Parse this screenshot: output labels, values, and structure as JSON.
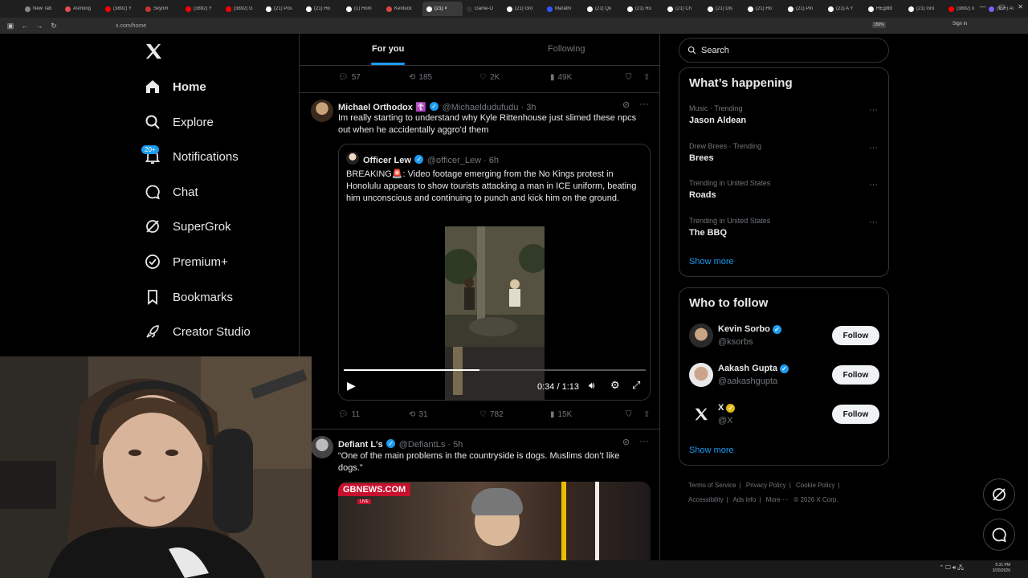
{
  "browser": {
    "tabs": [
      {
        "label": "New Tab",
        "color": "#888888"
      },
      {
        "label": "Asmong",
        "color": "#e44d4d"
      },
      {
        "label": "(3892) Y",
        "color": "#ff0000"
      },
      {
        "label": "Skyrim ",
        "color": "#cc3333"
      },
      {
        "label": "(3892) Y",
        "color": "#ff0000"
      },
      {
        "label": "(3892) G",
        "color": "#ff0000"
      },
      {
        "label": "(21) Pos",
        "color": "#ffffff"
      },
      {
        "label": "(21) Ho",
        "color": "#ffffff"
      },
      {
        "label": "(1) Hom",
        "color": "#ffffff"
      },
      {
        "label": "Kentuck",
        "color": "#d44"
      },
      {
        "label": "(21) ×",
        "color": "#ffffff",
        "active": true
      },
      {
        "label": "Game-O",
        "color": "#333"
      },
      {
        "label": "(21) Gro",
        "color": "#ffffff"
      },
      {
        "label": "Marathi",
        "color": "#3355ff"
      },
      {
        "label": "(21) Qu",
        "color": "#ffffff"
      },
      {
        "label": "(21) Ru",
        "color": "#ffffff"
      },
      {
        "label": "(21) Ch",
        "color": "#ffffff"
      },
      {
        "label": "(21) Dis",
        "color": "#ffffff"
      },
      {
        "label": "(21) Ho",
        "color": "#ffffff"
      },
      {
        "label": "(21) Pin",
        "color": "#ffffff"
      },
      {
        "label": "(21) A Y",
        "color": "#ffffff"
      },
      {
        "label": "HEg8bt",
        "color": "#ffffff"
      },
      {
        "label": "(21) Gro",
        "color": "#ffffff"
      },
      {
        "label": "(3892) o",
        "color": "#ff0000"
      },
      {
        "label": "(99+) Al",
        "color": "#7b61ff"
      },
      {
        "label": "r/Livesti",
        "color": "#ff4500"
      }
    ],
    "url": "x.com/home",
    "zoom": "150%",
    "signin": "Sign in"
  },
  "nav": {
    "items": [
      {
        "label": "Home",
        "icon": "home-icon"
      },
      {
        "label": "Explore",
        "icon": "search-icon"
      },
      {
        "label": "Notifications",
        "icon": "bell-icon"
      },
      {
        "label": "Chat",
        "icon": "chat-icon"
      },
      {
        "label": "SuperGrok",
        "icon": "grok-icon"
      },
      {
        "label": "Premium+",
        "icon": "premium-icon"
      },
      {
        "label": "Bookmarks",
        "icon": "bookmark-icon"
      },
      {
        "label": "Creator Studio",
        "icon": "rocket-icon"
      }
    ],
    "notif_badge": "20+"
  },
  "feed": {
    "tabs": [
      "For you",
      "Following"
    ],
    "prev_actions": {
      "replies": "57",
      "reposts": "185",
      "likes": "2K",
      "views": "49K"
    },
    "tweet1": {
      "name": "Michael Orthodox ☦️",
      "handle": "@Michaeldudufudu · 3h",
      "text": "Im really starting to understand why Kyle Rittenhouse just slimed these npcs out when he accidentally aggro'd them",
      "quote": {
        "name": "Officer Lew",
        "handle": "@officer_Lew · 6h",
        "text": "BREAKING🚨: Video footage emerging from the No Kings protest in Honolulu appears to show tourists attacking a man in ICE uniform, beating him unconscious and continuing to punch and kick him on the ground.",
        "video_time": "0:34 / 1:13",
        "video_progress": 0.45
      },
      "actions": {
        "replies": "11",
        "reposts": "31",
        "likes": "782",
        "views": "15K"
      }
    },
    "tweet2": {
      "name": "Defiant L's",
      "handle": "@DefiantLs · 5h",
      "text": "“One of the main problems in the countryside is dogs. Muslims don’t like dogs.”",
      "media_label": "GBNEWS.COM",
      "live_label": "LIVE"
    }
  },
  "right": {
    "search_placeholder": "Search",
    "whats_happening": "What’s happening",
    "trends": [
      {
        "meta": "Music · Trending",
        "name": "Jason Aldean"
      },
      {
        "meta": "Drew Brees · Trending",
        "name": "Brees"
      },
      {
        "meta": "Trending in United States",
        "name": "Roads"
      },
      {
        "meta": "Trending in United States",
        "name": "The BBQ"
      }
    ],
    "show_more": "Show more",
    "who_to_follow": "Who to follow",
    "follow_suggestions": [
      {
        "name": "Kevin Sorbo",
        "handle": "@ksorbs"
      },
      {
        "name": "Aakash Gupta",
        "handle": "@aakashgupta"
      },
      {
        "name": "X",
        "handle": "@X"
      }
    ],
    "follow_label": "Follow",
    "footer": [
      "Terms of Service",
      "|",
      "Privacy Policy",
      "|",
      "Cookie Policy",
      "|",
      "Accessibility",
      "|",
      "Ads info",
      "|",
      "More ···",
      "© 2026 X Corp."
    ]
  },
  "taskbar": {
    "time": "5:31 PM",
    "date": "3/30/2026"
  }
}
